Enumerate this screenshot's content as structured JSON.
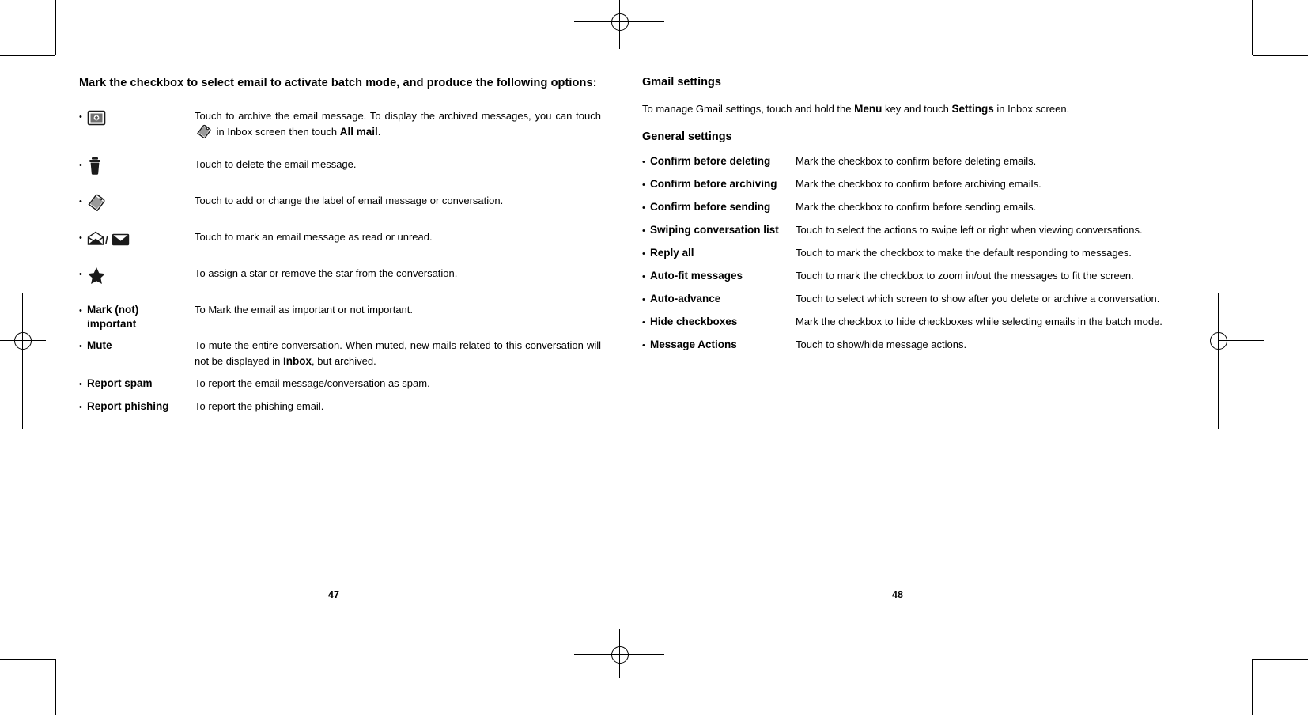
{
  "document": {
    "left_page": {
      "folio": "47",
      "intro": "Mark the checkbox to select email to activate batch mode, and produce the following options:",
      "rows": [
        {
          "icon": "archive-icon",
          "term": "",
          "desc_parts": [
            {
              "text": "Touch to archive the email message. To display the archived messages, you can touch "
            },
            {
              "icon": "label-tag-icon"
            },
            {
              "text": " in Inbox screen then touch "
            },
            {
              "text": "All mail",
              "bold": true
            },
            {
              "text": "."
            }
          ]
        },
        {
          "icon": "trash-icon",
          "term": "",
          "desc_parts": [
            {
              "text": "Touch to delete the email message."
            }
          ]
        },
        {
          "icon": "label-tag-icon",
          "term": "",
          "desc_parts": [
            {
              "text": "Touch to add or change the label of email message or conversation."
            }
          ]
        },
        {
          "icon": "mail-read-unread-icon",
          "term": "",
          "desc_parts": [
            {
              "text": "Touch to mark an email message as read or unread."
            }
          ]
        },
        {
          "icon": "star-icon",
          "term": "",
          "desc_parts": [
            {
              "text": "To assign a star or remove the star from the conversation."
            }
          ]
        },
        {
          "icon": "",
          "term": "Mark (not) important",
          "desc_parts": [
            {
              "text": "To Mark the email as important or not important."
            }
          ]
        },
        {
          "icon": "",
          "term": "Mute",
          "desc_parts": [
            {
              "text": "To mute the entire conversation. When muted, new mails related to this conversation will not be displayed in "
            },
            {
              "text": "Inbox",
              "bold": true
            },
            {
              "text": ", but archived."
            }
          ]
        },
        {
          "icon": "",
          "term": "Report spam",
          "desc_parts": [
            {
              "text": "To report the email message/conversation as spam."
            }
          ]
        },
        {
          "icon": "",
          "term": "Report phishing",
          "desc_parts": [
            {
              "text": "To report the phishing email."
            }
          ]
        }
      ]
    },
    "right_page": {
      "folio": "48",
      "heading_gmail_settings": "Gmail settings",
      "intro_parts": [
        {
          "text": "To manage Gmail settings, touch and hold the "
        },
        {
          "text": "Menu",
          "bold": true
        },
        {
          "text": " key and touch "
        },
        {
          "text": "Settings",
          "bold": true
        },
        {
          "text": " in Inbox screen."
        }
      ],
      "heading_general_settings": "General settings",
      "rows": [
        {
          "term": "Confirm before deleting",
          "desc": "Mark the checkbox to confirm before deleting emails."
        },
        {
          "term": "Confirm before archiving",
          "desc": "Mark the checkbox to confirm before archiving emails."
        },
        {
          "term": "Confirm before sending",
          "desc": "Mark the checkbox to confirm before sending emails."
        },
        {
          "term": "Swiping conversation list",
          "desc": "Touch to select the actions to swipe left or right when viewing conversations."
        },
        {
          "term": "Reply all",
          "desc": "Touch to mark the checkbox to make the default responding to messages.",
          "justify": true
        },
        {
          "term": "Auto-fit messages",
          "desc": "Touch to mark the checkbox to zoom in/out the messages to fit the screen."
        },
        {
          "term": "Auto-advance",
          "desc": "Touch to select which screen to show after you delete or archive a conversation."
        },
        {
          "term": "Hide checkboxes",
          "desc": "Mark the checkbox to hide checkboxes while selecting emails in the batch mode."
        },
        {
          "term": "Message Actions",
          "desc": "Touch to show/hide message actions."
        }
      ]
    }
  },
  "colors": {
    "text": "#000000",
    "page_background": "#ffffff"
  }
}
